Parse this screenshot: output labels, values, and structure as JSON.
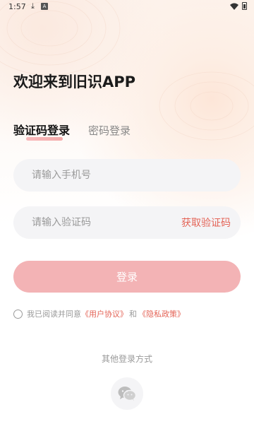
{
  "status_bar": {
    "time": "1:57"
  },
  "welcome_title": "欢迎来到旧识APP",
  "tabs": [
    {
      "label": "验证码登录",
      "active": true
    },
    {
      "label": "密码登录",
      "active": false
    }
  ],
  "phone_field": {
    "placeholder": "请输入手机号",
    "value": ""
  },
  "code_field": {
    "placeholder": "请输入验证码",
    "value": ""
  },
  "get_code_label": "获取验证码",
  "login_button": "登录",
  "agreement": {
    "prefix": "我已阅读并同意",
    "user_agreement": "《用户协议》",
    "conjunction": "和",
    "privacy_policy": "《隐私政策》",
    "checked": false
  },
  "other_login_label": "其他登录方式",
  "colors": {
    "accent": "#e46457",
    "button_bg": "#f3b3b5",
    "field_bg": "#f4f4f6"
  },
  "icons": [
    "download-icon",
    "sim-icon",
    "wifi-icon",
    "battery-icon",
    "wechat-icon"
  ]
}
